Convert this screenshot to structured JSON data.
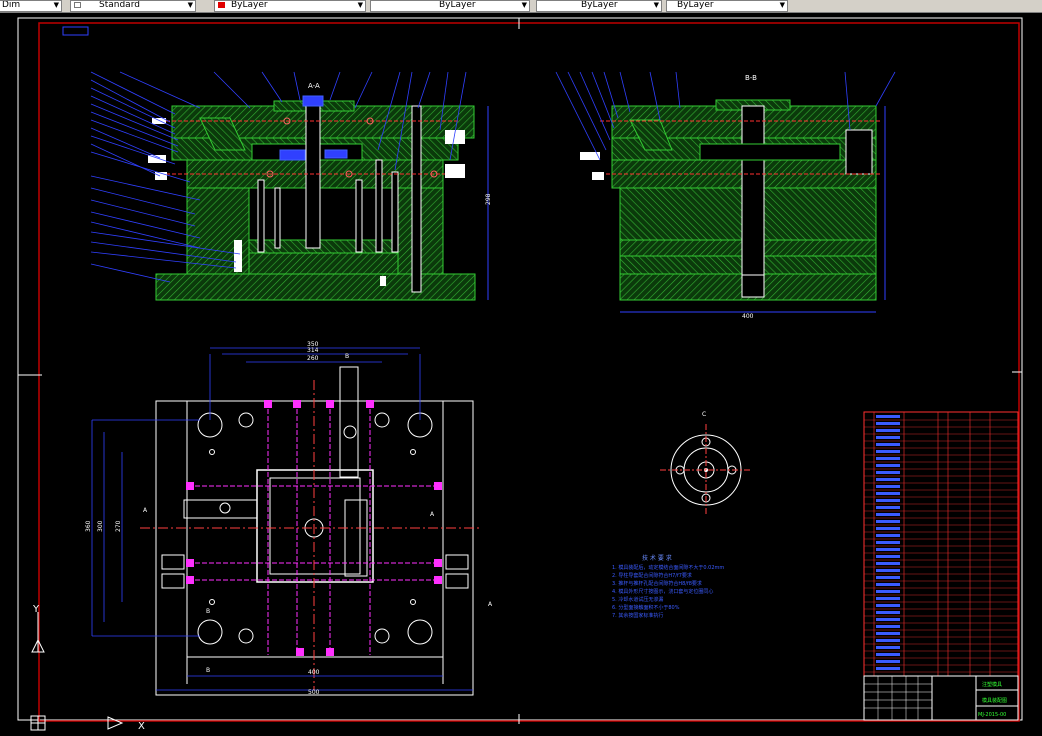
{
  "toolbar": {
    "dimstyle": "Dim",
    "textstyle": "Standard",
    "color": "ByLayer",
    "linetype": "ByLayer",
    "lineweight": "ByLayer",
    "plotstyle": "ByLayer"
  },
  "drawing": {
    "section_aa": "A-A",
    "section_bb": "B-B",
    "view_b1": "B",
    "label_a_left": "A",
    "label_a_right": "A",
    "label_b_top": "B",
    "label_b_bottom": "B",
    "label_a_bottom": "A",
    "detail_label": "C",
    "notes_title": "技 术 要 求",
    "notes": [
      "1. 模具装配后，动定模结合面间隙不大于0.02mm",
      "2. 导柱导套配合间隙符合H7/f7要求",
      "3. 推杆与推杆孔配合间隙符合H8/f8要求",
      "4. 模具外形尺寸按图示，浇口套与定位圈同心",
      "5. 冷却水道试压无渗漏",
      "6. 分型面接触面积不小于80%",
      "7. 其余按国家标准执行"
    ],
    "dims": {
      "top_w1": "350",
      "top_w2": "314",
      "top_w3": "260",
      "bottom_w1": "400",
      "bottom_w2": "500",
      "left_h1": "360",
      "left_h2": "300",
      "left_h3": "270",
      "right_width": "400",
      "height_total": "298"
    },
    "title_block": {
      "drawing_name": "模具装配图",
      "drawing_no": "MJ-2015-00",
      "company": "注塑模具"
    }
  },
  "ucs": {
    "y_label": "Y",
    "x_label": "X"
  }
}
